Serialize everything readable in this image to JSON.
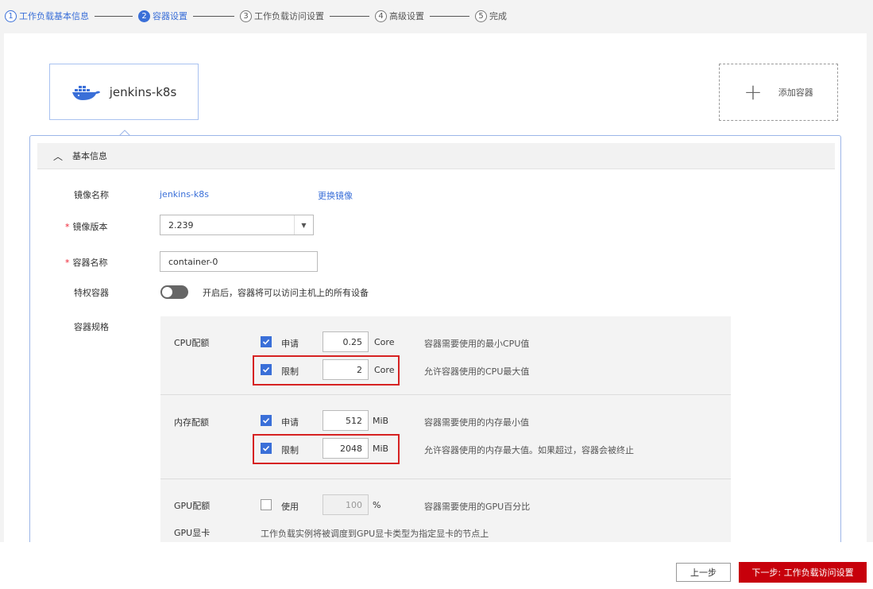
{
  "steps": [
    {
      "num": "1",
      "label": "工作负载基本信息",
      "state": "done"
    },
    {
      "num": "2",
      "label": "容器设置",
      "state": "active"
    },
    {
      "num": "3",
      "label": "工作负载访问设置",
      "state": "todo"
    },
    {
      "num": "4",
      "label": "高级设置",
      "state": "todo"
    },
    {
      "num": "5",
      "label": "完成",
      "state": "todo"
    }
  ],
  "container_tab": {
    "name": "jenkins-k8s",
    "icon": "docker-whale-icon"
  },
  "add_container": {
    "label": "添加容器",
    "icon": "plus-icon"
  },
  "section": {
    "title": "基本信息",
    "icon": "chevron-up-icon"
  },
  "form": {
    "image_name_label": "镜像名称",
    "image_name_value": "jenkins-k8s",
    "change_image_link": "更换镜像",
    "image_version_label": "镜像版本",
    "image_version_value": "2.239",
    "container_name_label": "容器名称",
    "container_name_value": "container-0",
    "privileged_label": "特权容器",
    "privileged_hint": "开启后，容器将可以访问主机上的所有设备",
    "privileged_enabled": false,
    "spec_label": "容器规格",
    "required_mark": "*"
  },
  "spec": {
    "cpu": {
      "label": "CPU配额",
      "request": {
        "label": "申请",
        "checked": true,
        "value": "0.25",
        "unit": "Core",
        "hint": "容器需要使用的最小CPU值"
      },
      "limit": {
        "label": "限制",
        "checked": true,
        "value": "2",
        "unit": "Core",
        "hint": "允许容器使用的CPU最大值"
      }
    },
    "memory": {
      "label": "内存配额",
      "request": {
        "label": "申请",
        "checked": true,
        "value": "512",
        "unit": "MiB",
        "hint": "容器需要使用的内存最小值"
      },
      "limit": {
        "label": "限制",
        "checked": true,
        "value": "2048",
        "unit": "MiB",
        "hint": "允许容器使用的内存最大值。如果超过，容器会被终止"
      }
    },
    "gpu": {
      "label": "GPU配额",
      "use": {
        "label": "使用",
        "checked": false,
        "value": "100",
        "unit": "%",
        "hint": "容器需要使用的GPU百分比"
      }
    },
    "gpu_card": {
      "label": "GPU显卡",
      "hint": "工作负载实例将被调度到GPU显卡类型为指定显卡的节点上"
    }
  },
  "footer": {
    "prev_label": "上一步",
    "next_label": "下一步: 工作负载访问设置"
  },
  "colors": {
    "accent": "#3a6fd8",
    "primary_button": "#c7000b",
    "highlight_box": "#d62222"
  }
}
